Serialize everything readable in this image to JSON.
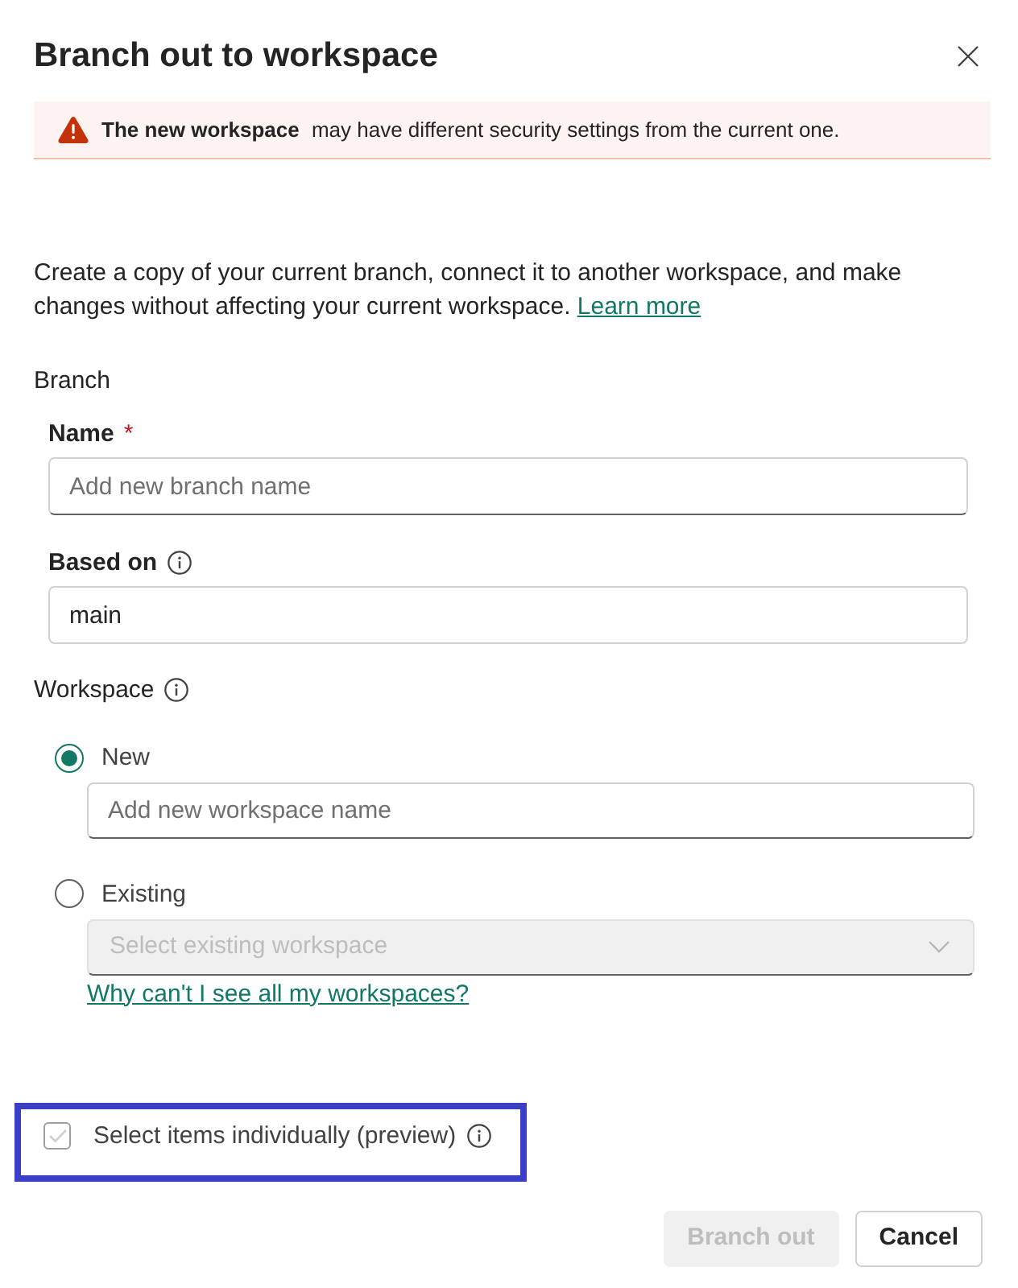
{
  "dialog": {
    "title": "Branch out to workspace"
  },
  "warning": {
    "message": "**The new workspace** may have different security settings from the current one."
  },
  "description": {
    "text": "Create a copy of your current branch, connect it to another workspace, and make changes without affecting your current workspace.",
    "link": "Learn more"
  },
  "branch": {
    "heading": "Branch",
    "fields": [
      {
        "label": "Name",
        "required_mark": "*",
        "placeholder": "Add new branch name"
      },
      {
        "label": "Based on",
        "info": true,
        "value": "main"
      }
    ]
  },
  "workspace": {
    "heading": "Workspace",
    "info": true,
    "options": [
      {
        "label": "New",
        "selected": true,
        "kind": "text",
        "disabled": false,
        "placeholder": "Add new workspace name"
      },
      {
        "label": "Existing",
        "selected": false,
        "kind": "dropdown",
        "disabled": true,
        "placeholder": "Select existing workspace"
      }
    ],
    "help_link": "Why can't I see all my workspaces?"
  },
  "select_individually": {
    "label": "Select items individually (preview)",
    "info": true,
    "checked": false,
    "hovered": true,
    "highlighted": true
  },
  "buttons": [
    {
      "label": "Branch out",
      "kind": "primary",
      "disabled": true
    },
    {
      "label": "Cancel",
      "kind": "secondary",
      "disabled": false
    }
  ]
}
